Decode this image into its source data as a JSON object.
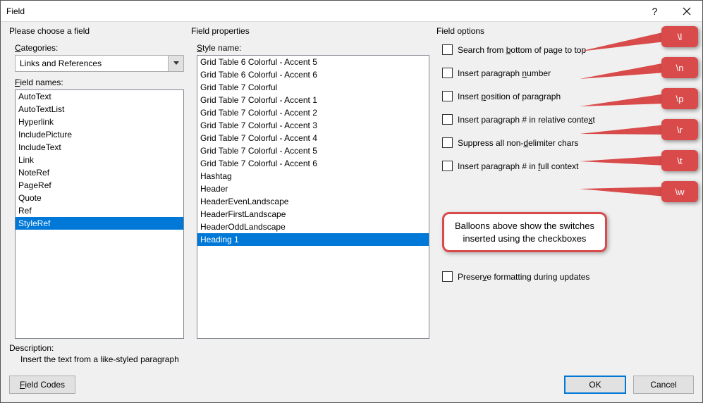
{
  "titlebar": {
    "title": "Field"
  },
  "left": {
    "section": "Please choose a field",
    "categories_label": "Categories:",
    "categories_value": "Links and References",
    "fieldnames_label": "Field names:",
    "fieldnames": [
      "AutoText",
      "AutoTextList",
      "Hyperlink",
      "IncludePicture",
      "IncludeText",
      "Link",
      "NoteRef",
      "PageRef",
      "Quote",
      "Ref",
      "StyleRef"
    ],
    "fieldnames_selected": "StyleRef"
  },
  "mid": {
    "section": "Field properties",
    "style_label": "Style name:",
    "styles": [
      "Grid Table 6 Colorful - Accent 5",
      "Grid Table 6 Colorful - Accent 6",
      "Grid Table 7 Colorful",
      "Grid Table 7 Colorful - Accent 1",
      "Grid Table 7 Colorful - Accent 2",
      "Grid Table 7 Colorful - Accent 3",
      "Grid Table 7 Colorful - Accent 4",
      "Grid Table 7 Colorful - Accent 5",
      "Grid Table 7 Colorful - Accent 6",
      "Hashtag",
      "Header",
      "HeaderEvenLandscape",
      "HeaderFirstLandscape",
      "HeaderOddLandscape",
      "Heading 1"
    ],
    "styles_selected": "Heading 1"
  },
  "right": {
    "section": "Field options",
    "opts": [
      {
        "pre": "Search from ",
        "u": "b",
        "post": "ottom of page to top"
      },
      {
        "pre": "Insert paragraph ",
        "u": "n",
        "post": "umber"
      },
      {
        "pre": "Insert ",
        "u": "p",
        "post": "osition of paragraph"
      },
      {
        "pre": "Insert paragraph # in relative conte",
        "u": "x",
        "post": "t"
      },
      {
        "pre": "Suppress all non-",
        "u": "d",
        "post": "elimiter chars"
      },
      {
        "pre": "Insert paragraph # in ",
        "u": "f",
        "post": "ull context"
      }
    ],
    "preserve": {
      "pre": "Preser",
      "u": "v",
      "post": "e formatting during updates"
    },
    "balloons": [
      "\\l",
      "\\n",
      "\\p",
      "\\r",
      "\\t",
      "\\w"
    ],
    "infobox": "Balloons above show the switches inserted using the checkboxes"
  },
  "desc": {
    "label": "Description:",
    "text": "Insert the text from a like-styled paragraph"
  },
  "buttons": {
    "field_codes": "Field Codes",
    "ok": "OK",
    "cancel": "Cancel"
  }
}
